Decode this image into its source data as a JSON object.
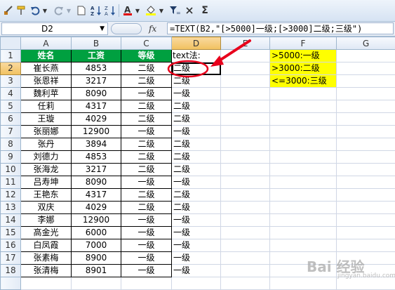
{
  "formula_bar": {
    "name_box": "D2",
    "fx_label": "fx",
    "formula": "=TEXT(B2,\"[>5000]一级;[>3000]二级;三级\")"
  },
  "columns": [
    "A",
    "B",
    "C",
    "D",
    "E",
    "F",
    "G"
  ],
  "headers": {
    "name": "姓名",
    "salary": "工资",
    "grade": "等级"
  },
  "d1_text": "text法:",
  "rows": [
    {
      "num": "2",
      "name": "崔长燕",
      "salary": "4853",
      "grade": "二级",
      "d": "二级"
    },
    {
      "num": "3",
      "name": "张恩祥",
      "salary": "3217",
      "grade": "二级",
      "d": "二级"
    },
    {
      "num": "4",
      "name": "魏利苹",
      "salary": "8090",
      "grade": "一级",
      "d": "一级"
    },
    {
      "num": "5",
      "name": "任莉",
      "salary": "4317",
      "grade": "二级",
      "d": "二级"
    },
    {
      "num": "6",
      "name": "王璇",
      "salary": "4029",
      "grade": "二级",
      "d": "二级"
    },
    {
      "num": "7",
      "name": "张丽娜",
      "salary": "12900",
      "grade": "一级",
      "d": "一级"
    },
    {
      "num": "8",
      "name": "张丹",
      "salary": "3894",
      "grade": "二级",
      "d": "二级"
    },
    {
      "num": "9",
      "name": "刘德力",
      "salary": "4853",
      "grade": "二级",
      "d": "二级"
    },
    {
      "num": "10",
      "name": "张海龙",
      "salary": "3217",
      "grade": "二级",
      "d": "二级"
    },
    {
      "num": "11",
      "name": "吕寿坤",
      "salary": "8090",
      "grade": "一级",
      "d": "一级"
    },
    {
      "num": "12",
      "name": "王艳东",
      "salary": "4317",
      "grade": "二级",
      "d": "二级"
    },
    {
      "num": "13",
      "name": "双庆",
      "salary": "4029",
      "grade": "二级",
      "d": "二级"
    },
    {
      "num": "14",
      "name": "李娜",
      "salary": "12900",
      "grade": "一级",
      "d": "一级"
    },
    {
      "num": "15",
      "name": "高金光",
      "salary": "6000",
      "grade": "一级",
      "d": "一级"
    },
    {
      "num": "16",
      "name": "白凤霞",
      "salary": "7000",
      "grade": "一级",
      "d": "一级"
    },
    {
      "num": "17",
      "name": "张素梅",
      "salary": "8900",
      "grade": "一级",
      "d": "一级"
    },
    {
      "num": "18",
      "name": "张清梅",
      "salary": "8901",
      "grade": "一级",
      "d": "一级"
    }
  ],
  "legend": [
    ">5000:一级",
    ">3000:二级",
    "<=3000:三级"
  ],
  "watermark": {
    "main": "Bai 经验",
    "sub": "jingyan.baidu.com"
  },
  "colors": {
    "header_green": "#00a040",
    "legend_yellow": "#ffff00",
    "annotation_red": "#e8001c"
  }
}
